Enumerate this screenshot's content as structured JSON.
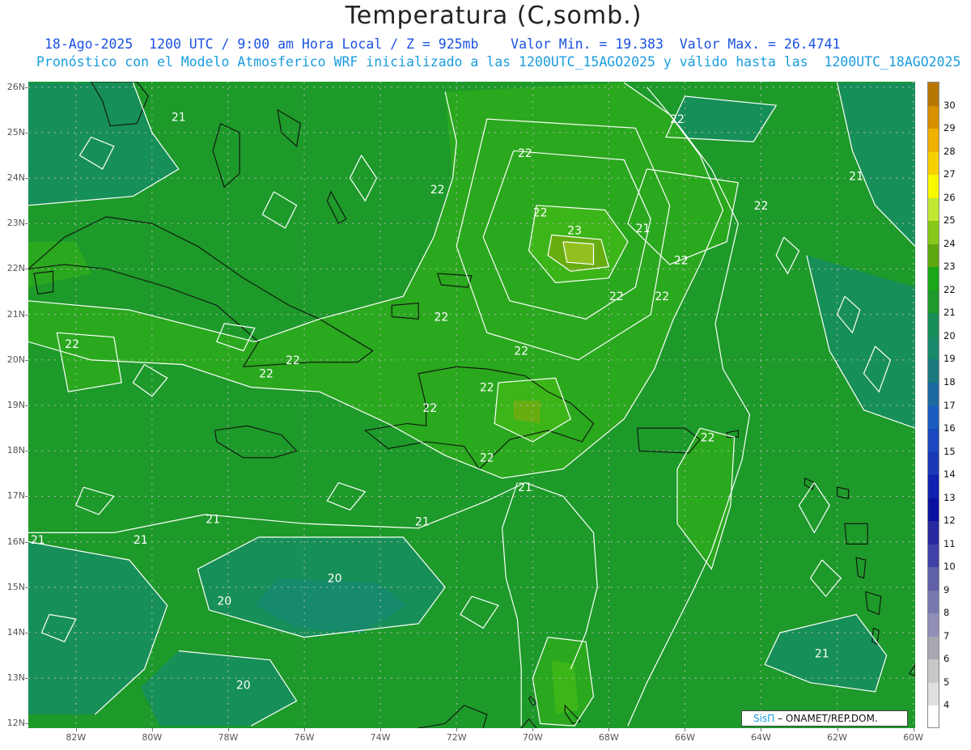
{
  "header": {
    "title": "Temperatura (C,somb.)",
    "line1": "18-Ago-2025  1200 UTC / 9:00 am Hora Local / Z = 925mb    Valor Min. = 19.383  Valor Max. = 26.4741",
    "line2": "Pronóstico con el Modelo Atmosferico WRF inicializado a las 1200UTC_15AGO2025 y válido hasta las  1200UTC_18AGO2025"
  },
  "map": {
    "lat_labels": [
      "26N",
      "25N",
      "24N",
      "23N",
      "22N",
      "21N",
      "20N",
      "19N",
      "18N",
      "17N",
      "16N",
      "15N",
      "14N",
      "13N",
      "12N"
    ],
    "lon_labels": [
      "82W",
      "80W",
      "78W",
      "76W",
      "74W",
      "72W",
      "70W",
      "68W",
      "66W",
      "64W",
      "62W",
      "60W"
    ],
    "contour_labels": [
      {
        "text": "21",
        "lon": -79.3,
        "lat": 25.35
      },
      {
        "text": "22",
        "lon": -72.5,
        "lat": 23.75
      },
      {
        "text": "22",
        "lon": -70.2,
        "lat": 24.55
      },
      {
        "text": "22",
        "lon": -66.2,
        "lat": 25.3
      },
      {
        "text": "21",
        "lon": -61.5,
        "lat": 24.05
      },
      {
        "text": "22",
        "lon": -64.0,
        "lat": 23.4
      },
      {
        "text": "22",
        "lon": -69.8,
        "lat": 23.25
      },
      {
        "text": "23",
        "lon": -68.9,
        "lat": 22.85
      },
      {
        "text": "21",
        "lon": -67.1,
        "lat": 22.9
      },
      {
        "text": "22",
        "lon": -66.1,
        "lat": 22.2
      },
      {
        "text": "22",
        "lon": -66.6,
        "lat": 21.4
      },
      {
        "text": "22",
        "lon": -67.8,
        "lat": 21.4
      },
      {
        "text": "22",
        "lon": -72.4,
        "lat": 20.95
      },
      {
        "text": "22",
        "lon": -82.1,
        "lat": 20.35
      },
      {
        "text": "22",
        "lon": -76.3,
        "lat": 20.0
      },
      {
        "text": "22",
        "lon": -77.0,
        "lat": 19.7
      },
      {
        "text": "22",
        "lon": -70.3,
        "lat": 20.2
      },
      {
        "text": "22",
        "lon": -71.2,
        "lat": 19.4
      },
      {
        "text": "22",
        "lon": -72.7,
        "lat": 18.95
      },
      {
        "text": "22",
        "lon": -65.4,
        "lat": 18.3
      },
      {
        "text": "22",
        "lon": -71.2,
        "lat": 17.85
      },
      {
        "text": "21",
        "lon": -70.2,
        "lat": 17.2
      },
      {
        "text": "21",
        "lon": -78.4,
        "lat": 16.5
      },
      {
        "text": "21",
        "lon": -72.9,
        "lat": 16.45
      },
      {
        "text": "21",
        "lon": -80.3,
        "lat": 16.05
      },
      {
        "text": "21",
        "lon": -83.0,
        "lat": 16.05
      },
      {
        "text": "20",
        "lon": -75.2,
        "lat": 15.2
      },
      {
        "text": "20",
        "lon": -78.1,
        "lat": 14.7
      },
      {
        "text": "20",
        "lon": -77.6,
        "lat": 12.85
      },
      {
        "text": "21",
        "lon": -62.4,
        "lat": 13.55
      }
    ],
    "field_colors": {
      "t19": "#168a6a",
      "t20": "#178f58",
      "t21": "#1d9a2a",
      "t22": "#2aa81e",
      "t23": "#3cb518",
      "t24": "#68ad10",
      "t25": "#92c020",
      "contour": "#ffffff",
      "coast": "#111111",
      "grid": "#b8b8b8"
    }
  },
  "colorbar": {
    "labels": [
      "30",
      "29",
      "28",
      "27",
      "26",
      "25",
      "24",
      "23",
      "22",
      "21",
      "20",
      "19",
      "18",
      "17",
      "16",
      "15",
      "14",
      "13",
      "12",
      "11",
      "10",
      "9",
      "8",
      "7",
      "6",
      "5",
      "4"
    ],
    "colors": [
      "#b87800",
      "#d89000",
      "#f0b000",
      "#f8d000",
      "#f8f800",
      "#c0e830",
      "#88c818",
      "#60a810",
      "#18a818",
      "#1d9a2a",
      "#178f58",
      "#168a6a",
      "#1a7a80",
      "#1a6aa0",
      "#1a5cc0",
      "#1a48c0",
      "#1a38b8",
      "#1020b0",
      "#0a10a0",
      "#2828a0",
      "#4040a8",
      "#6060a8",
      "#7878b0",
      "#9090b8",
      "#a8a8b0",
      "#c8c8c8",
      "#e0e0e0",
      "#ffffff"
    ]
  },
  "credit": {
    "system": "SisΠ",
    "org": "– ONAMET/REP.DOM."
  }
}
